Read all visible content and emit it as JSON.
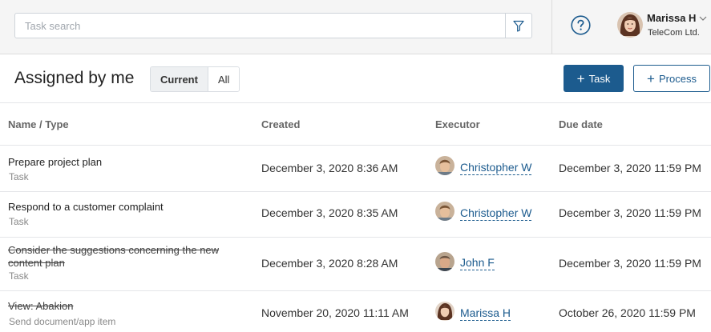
{
  "search": {
    "placeholder": "Task search"
  },
  "user": {
    "name": "Marissa H",
    "company": "TeleCom Ltd."
  },
  "header": {
    "title": "Assigned by me",
    "toggle": {
      "current": "Current",
      "all": "All"
    },
    "task_button": "Task",
    "process_button": "Process"
  },
  "table": {
    "columns": {
      "name": "Name / Type",
      "created": "Created",
      "executor": "Executor",
      "due": "Due date"
    },
    "rows": [
      {
        "name": "Prepare project plan",
        "type": "Task",
        "created": "December 3, 2020 8:36 AM",
        "executor": "Christopher W",
        "due": "December 3, 2020 11:59 PM",
        "completed": false
      },
      {
        "name": "Respond to a customer complaint",
        "type": "Task",
        "created": "December 3, 2020 8:35 AM",
        "executor": "Christopher W",
        "due": "December 3, 2020 11:59 PM",
        "completed": false
      },
      {
        "name": "Consider the suggestions concerning the new content plan",
        "type": "Task",
        "created": "December 3, 2020 8:28 AM",
        "executor": "John F",
        "due": "December 3, 2020 11:59 PM",
        "completed": true
      },
      {
        "name": "View: Abakion",
        "type": "Send document/app item",
        "created": "November 20, 2020 11:11 AM",
        "executor": "Marissa H",
        "due": "October 26, 2020 11:59 PM",
        "completed": true
      }
    ]
  },
  "icons": {
    "filter": "filter-icon",
    "help": "help-circle-icon",
    "chevron": "chevron-down-icon",
    "plus": "plus-icon"
  },
  "colors": {
    "accent": "#1c5b8e",
    "topbar_bg": "#f5f5f5"
  }
}
